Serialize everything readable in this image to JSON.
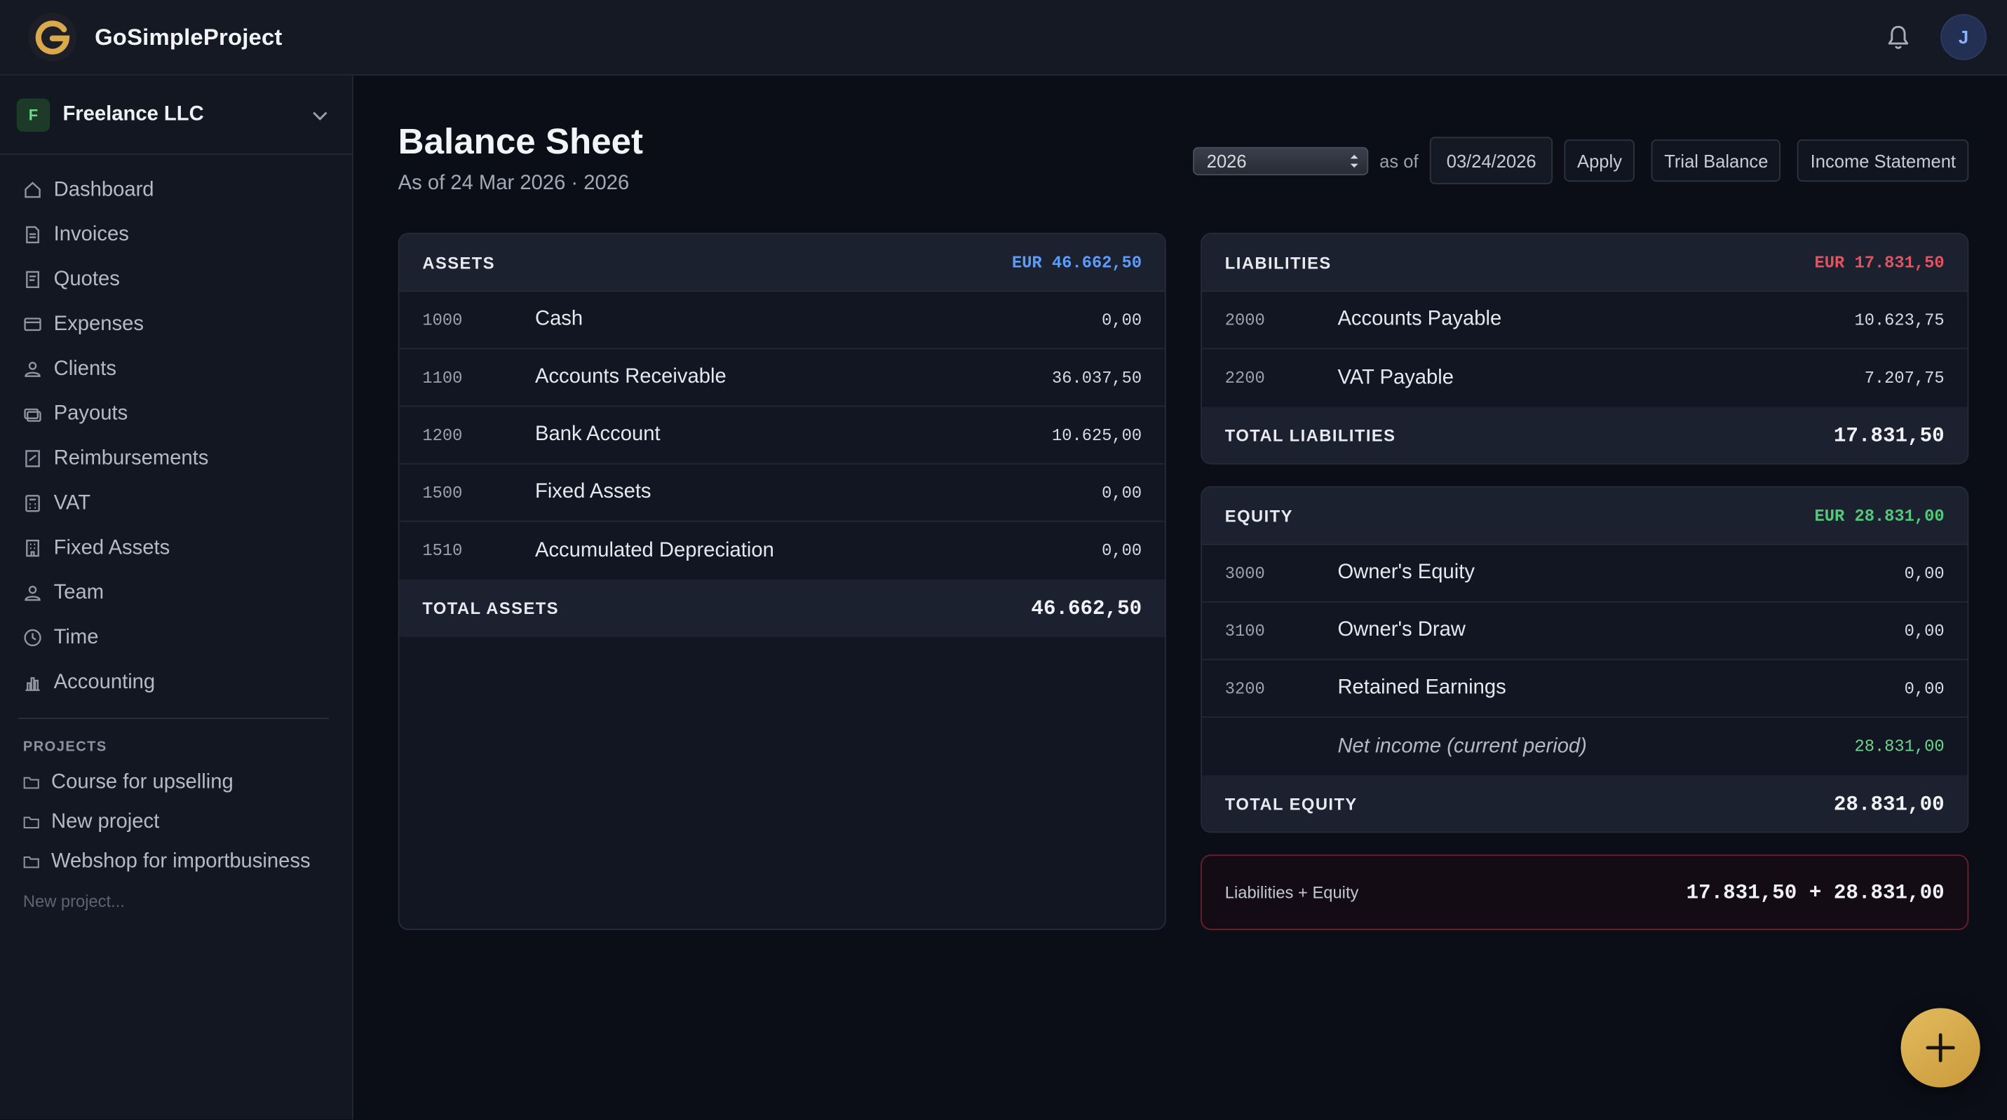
{
  "app": {
    "brand": "GoSimpleProject"
  },
  "user": {
    "initial": "J"
  },
  "org": {
    "badge": "F",
    "name": "Freelance LLC"
  },
  "nav": [
    {
      "label": "Dashboard",
      "icon": "home-icon"
    },
    {
      "label": "Invoices",
      "icon": "document-icon"
    },
    {
      "label": "Quotes",
      "icon": "quote-icon"
    },
    {
      "label": "Expenses",
      "icon": "card-icon"
    },
    {
      "label": "Clients",
      "icon": "clients-icon"
    },
    {
      "label": "Payouts",
      "icon": "payouts-icon"
    },
    {
      "label": "Reimbursements",
      "icon": "receipt-icon"
    },
    {
      "label": "VAT",
      "icon": "calculator-icon"
    },
    {
      "label": "Fixed Assets",
      "icon": "building-icon"
    },
    {
      "label": "Team",
      "icon": "team-icon"
    },
    {
      "label": "Time",
      "icon": "clock-icon"
    },
    {
      "label": "Accounting",
      "icon": "chart-icon"
    }
  ],
  "projects": {
    "label": "PROJECTS",
    "items": [
      "Course for upselling",
      "New project",
      "Webshop for importbusiness"
    ],
    "new_placeholder": "New project..."
  },
  "page": {
    "title": "Balance Sheet",
    "subtitle": "As of 24 Mar 2026 · 2026"
  },
  "controls": {
    "year": "2026",
    "as_of": "as of",
    "date": "03/24/2026",
    "apply": "Apply",
    "trial_balance": "Trial Balance",
    "income_statement": "Income Statement"
  },
  "assets": {
    "title": "ASSETS",
    "total": "EUR 46.662,50",
    "rows": [
      {
        "code": "1000",
        "name": "Cash",
        "amount": "0,00"
      },
      {
        "code": "1100",
        "name": "Accounts Receivable",
        "amount": "36.037,50"
      },
      {
        "code": "1200",
        "name": "Bank Account",
        "amount": "10.625,00"
      },
      {
        "code": "1500",
        "name": "Fixed Assets",
        "amount": "0,00"
      },
      {
        "code": "1510",
        "name": "Accumulated Depreciation",
        "amount": "0,00"
      }
    ],
    "total_label": "TOTAL ASSETS",
    "total_value": "46.662,50"
  },
  "liabilities": {
    "title": "LIABILITIES",
    "total": "EUR 17.831,50",
    "rows": [
      {
        "code": "2000",
        "name": "Accounts Payable",
        "amount": "10.623,75"
      },
      {
        "code": "2200",
        "name": "VAT Payable",
        "amount": "7.207,75"
      }
    ],
    "total_label": "TOTAL LIABILITIES",
    "total_value": "17.831,50"
  },
  "equity": {
    "title": "EQUITY",
    "total": "EUR 28.831,00",
    "rows": [
      {
        "code": "3000",
        "name": "Owner's Equity",
        "amount": "0,00"
      },
      {
        "code": "3100",
        "name": "Owner's Draw",
        "amount": "0,00"
      },
      {
        "code": "3200",
        "name": "Retained Earnings",
        "amount": "0,00"
      }
    ],
    "net_income": {
      "name": "Net income (current period)",
      "amount": "28.831,00"
    },
    "total_label": "TOTAL EQUITY",
    "total_value": "28.831,00"
  },
  "check": {
    "label": "Liabilities + Equity",
    "value": "17.831,50 + 28.831,00"
  },
  "colors": {
    "assets_total": "#5b9cff",
    "liabilities_total": "#e0545f",
    "equity_total": "#52c878",
    "fab": "#d6ab4a"
  }
}
